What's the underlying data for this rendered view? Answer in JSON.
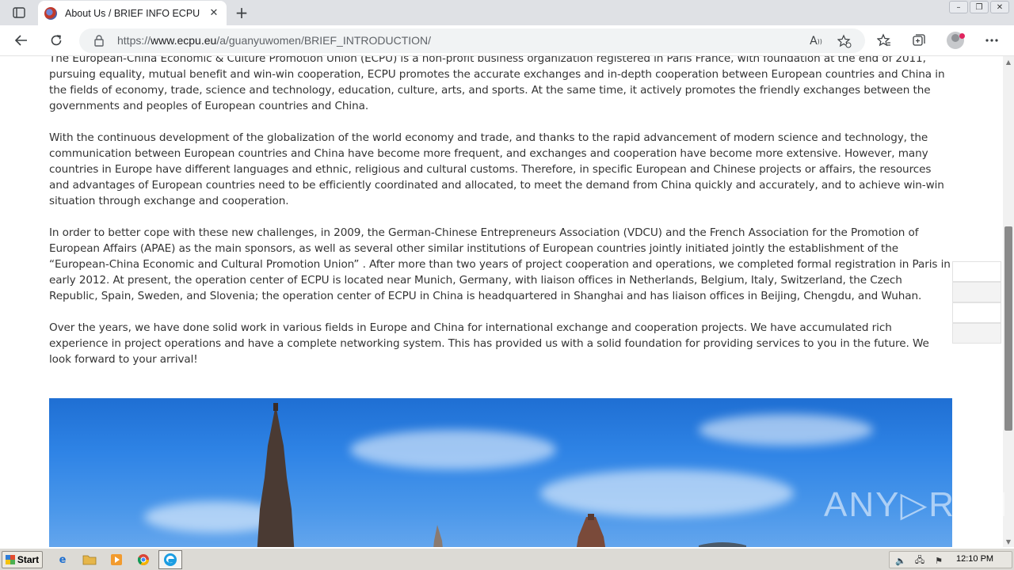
{
  "browser": {
    "tab": {
      "title": "About Us / BRIEF INFO ECPU",
      "close_glyph": "✕"
    },
    "new_tab_glyph": "+",
    "address": {
      "scheme": "https://",
      "host": "www.ecpu.eu",
      "path": "/a/guanyuwomen/BRIEF_INTRODUCTION/"
    },
    "window_controls": [
      "–",
      "❐",
      "✕"
    ]
  },
  "page": {
    "paragraphs": [
      "The European-China Economic & Culture Promotion Union (ECPU) is a non-profit business organization registered in Paris France, with foundation at the end of 2011, pursuing equality, mutual benefit and win-win cooperation, ECPU promotes the accurate exchanges and in-depth cooperation between European countries and China in the fields of economy, trade, science and technology, education, culture, arts, and sports. At the same time, it actively promotes the friendly exchanges between the governments and peoples of European countries and China.",
      "With the continuous development of the globalization of the world economy and trade, and thanks to the rapid advancement of modern science and technology, the communication between European countries and China have become more frequent, and exchanges and cooperation have become more extensive. However, many countries in Europe have different languages and ethnic, religious and cultural customs. Therefore, in specific European and Chinese projects or affairs, the resources and advantages of European countries need to be efficiently coordinated and allocated, to meet the demand from China quickly and accurately, and to achieve  win-win situation through exchange and cooperation.",
      "In order to better cope with these new challenges, in 2009, the German-Chinese Entrepreneurs Association (VDCU) and the French Association for the Promotion of European Affairs (APAE) as the main sponsors, as well as several other similar institutions of European countries jointly initiated jointly the establishment of the  “European-China Economic and Cultural Promotion Union” . After more than two years of project cooperation and operations, we completed formal registration in Paris in early 2012. At present, the operation center of ECPU is located near Munich, Germany, with liaison offices in Netherlands, Belgium, Italy, Switzerland, the Czech Republic, Spain, Sweden, and Slovenia; the operation center of ECPU in China is headquartered in Shanghai and has liaison offices in Beijing, Chengdu, and Wuhan.",
      "Over the years, we have done solid work in various fields in Europe and China for international exchange and cooperation projects. We have accumulated rich experience in project operations and have a complete networking system. This has provided us with a solid foundation for providing services to you in the future. We look forward to your arrival!"
    ]
  },
  "watermark": "ANY▷RUN",
  "taskbar": {
    "start_label": "Start",
    "clock": "12:10 PM"
  },
  "icons": {
    "tab_actions": "tab-actions-icon",
    "back": "back-arrow-icon",
    "reload": "reload-icon",
    "lock": "lock-icon",
    "read_aloud": "read-aloud-icon",
    "add_favorite": "add-favorite-icon",
    "favorites": "favorites-icon",
    "collections": "collections-icon",
    "more": "more-icon"
  },
  "colors": {
    "tabstrip": "#dfe1e5",
    "omnibox": "#f1f3f4",
    "text": "#333333",
    "sky": "#2f84e6",
    "taskbar": "#dcdad5"
  }
}
